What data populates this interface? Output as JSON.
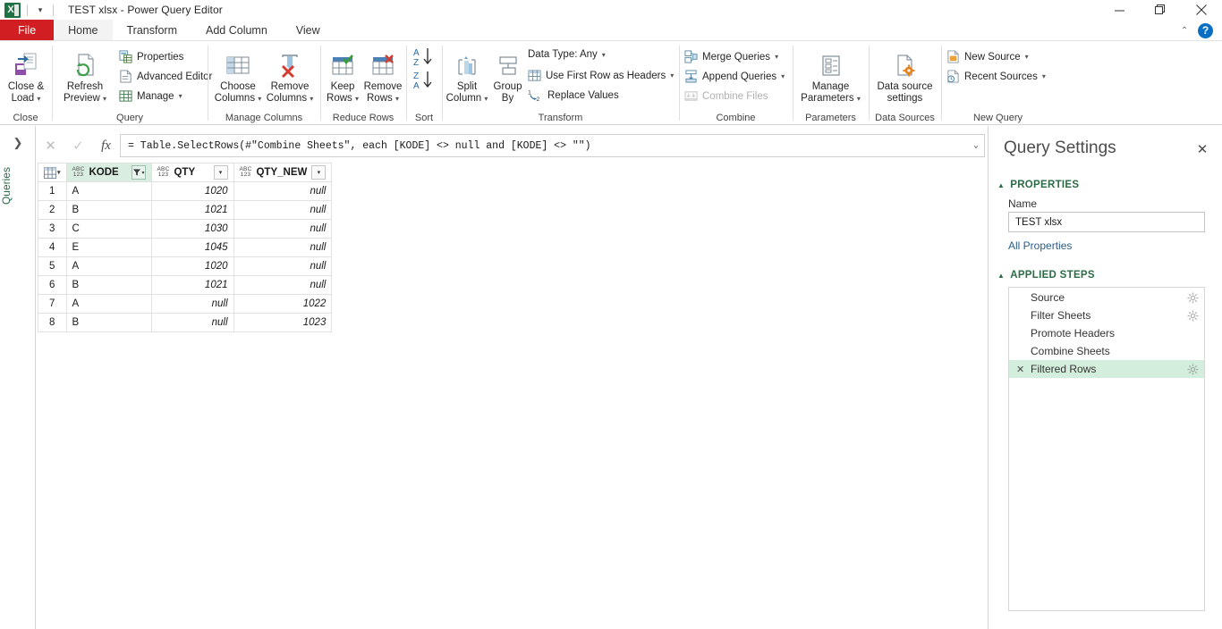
{
  "window": {
    "title": "TEST xlsx - Power Query Editor",
    "app_icon": "excel-icon",
    "qat_dropdown": "▾",
    "minimize": "minimize-icon",
    "restore": "restore-icon",
    "close": "close-icon",
    "collapse_ribbon": "⌃",
    "help": "?"
  },
  "tabs": [
    {
      "label": "File",
      "kind": "file"
    },
    {
      "label": "Home",
      "kind": "active"
    },
    {
      "label": "Transform",
      "kind": "normal"
    },
    {
      "label": "Add Column",
      "kind": "normal"
    },
    {
      "label": "View",
      "kind": "normal"
    }
  ],
  "ribbon": {
    "groups": [
      {
        "label": "Close"
      },
      {
        "label": "Query"
      },
      {
        "label": "Manage Columns"
      },
      {
        "label": "Reduce Rows"
      },
      {
        "label": "Sort"
      },
      {
        "label": "Transform"
      },
      {
        "label": "Combine"
      },
      {
        "label": "Parameters"
      },
      {
        "label": "Data Sources"
      },
      {
        "label": "New Query"
      }
    ],
    "close_load": "Close &\nLoad",
    "refresh_preview": "Refresh\nPreview",
    "properties": "Properties",
    "advanced_editor": "Advanced Editor",
    "manage": "Manage",
    "choose_columns": "Choose\nColumns",
    "remove_columns": "Remove\nColumns",
    "keep_rows": "Keep\nRows",
    "remove_rows": "Remove\nRows",
    "split_column": "Split\nColumn",
    "group_by": "Group\nBy",
    "data_type": "Data Type: Any",
    "use_first_row": "Use First Row as Headers",
    "replace_values": "Replace Values",
    "merge_queries": "Merge Queries",
    "append_queries": "Append Queries",
    "combine_files": "Combine Files",
    "manage_parameters": "Manage\nParameters",
    "data_source_settings": "Data source\nsettings",
    "new_source": "New Source",
    "recent_sources": "Recent Sources"
  },
  "rail": {
    "expand_icon": "❯",
    "label": "Queries"
  },
  "formula_bar": {
    "cancel_icon": "✕",
    "accept_icon": "✓",
    "fx_icon": "fx",
    "value": "= Table.SelectRows(#\"Combine Sheets\", each [KODE] <> null and [KODE] <> \"\")",
    "expand_icon": "⌄"
  },
  "grid": {
    "corner_icon": "table-icon",
    "type_icon": "ABC\n123",
    "columns": [
      {
        "name": "KODE",
        "type_line1": "ABC",
        "type_line2": "123",
        "filtered": true
      },
      {
        "name": "QTY",
        "type_line1": "ABC",
        "type_line2": "123",
        "filtered": false
      },
      {
        "name": "QTY_NEW",
        "type_line1": "ABC",
        "type_line2": "123",
        "filtered": false
      }
    ],
    "rows": [
      {
        "n": "1",
        "KODE": "A",
        "QTY": "1020",
        "QTY_NEW": "null"
      },
      {
        "n": "2",
        "KODE": "B",
        "QTY": "1021",
        "QTY_NEW": "null"
      },
      {
        "n": "3",
        "KODE": "C",
        "QTY": "1030",
        "QTY_NEW": "null"
      },
      {
        "n": "4",
        "KODE": "E",
        "QTY": "1045",
        "QTY_NEW": "null"
      },
      {
        "n": "5",
        "KODE": "A",
        "QTY": "1020",
        "QTY_NEW": "null"
      },
      {
        "n": "6",
        "KODE": "B",
        "QTY": "1021",
        "QTY_NEW": "null"
      },
      {
        "n": "7",
        "KODE": "A",
        "QTY": "null",
        "QTY_NEW": "1022"
      },
      {
        "n": "8",
        "KODE": "B",
        "QTY": "null",
        "QTY_NEW": "1023"
      }
    ]
  },
  "query_settings": {
    "title": "Query Settings",
    "close_icon": "✕",
    "properties_header": "PROPERTIES",
    "name_label": "Name",
    "name_value": "TEST xlsx",
    "all_properties": "All Properties",
    "applied_steps_header": "APPLIED STEPS",
    "steps": [
      {
        "label": "Source",
        "active": false,
        "gear": true,
        "deletable": false
      },
      {
        "label": "Filter Sheets",
        "active": false,
        "gear": true,
        "deletable": false
      },
      {
        "label": "Promote Headers",
        "active": false,
        "gear": false,
        "deletable": false
      },
      {
        "label": "Combine Sheets",
        "active": false,
        "gear": false,
        "deletable": false
      },
      {
        "label": "Filtered Rows",
        "active": true,
        "gear": true,
        "deletable": true
      }
    ],
    "delete_icon": "✕"
  },
  "colors": {
    "accent_green": "#2c6b46",
    "selection_green": "#d4eedd",
    "column_green": "#d9efe2",
    "file_red": "#d01e23",
    "help_blue": "#0a6fc2"
  }
}
